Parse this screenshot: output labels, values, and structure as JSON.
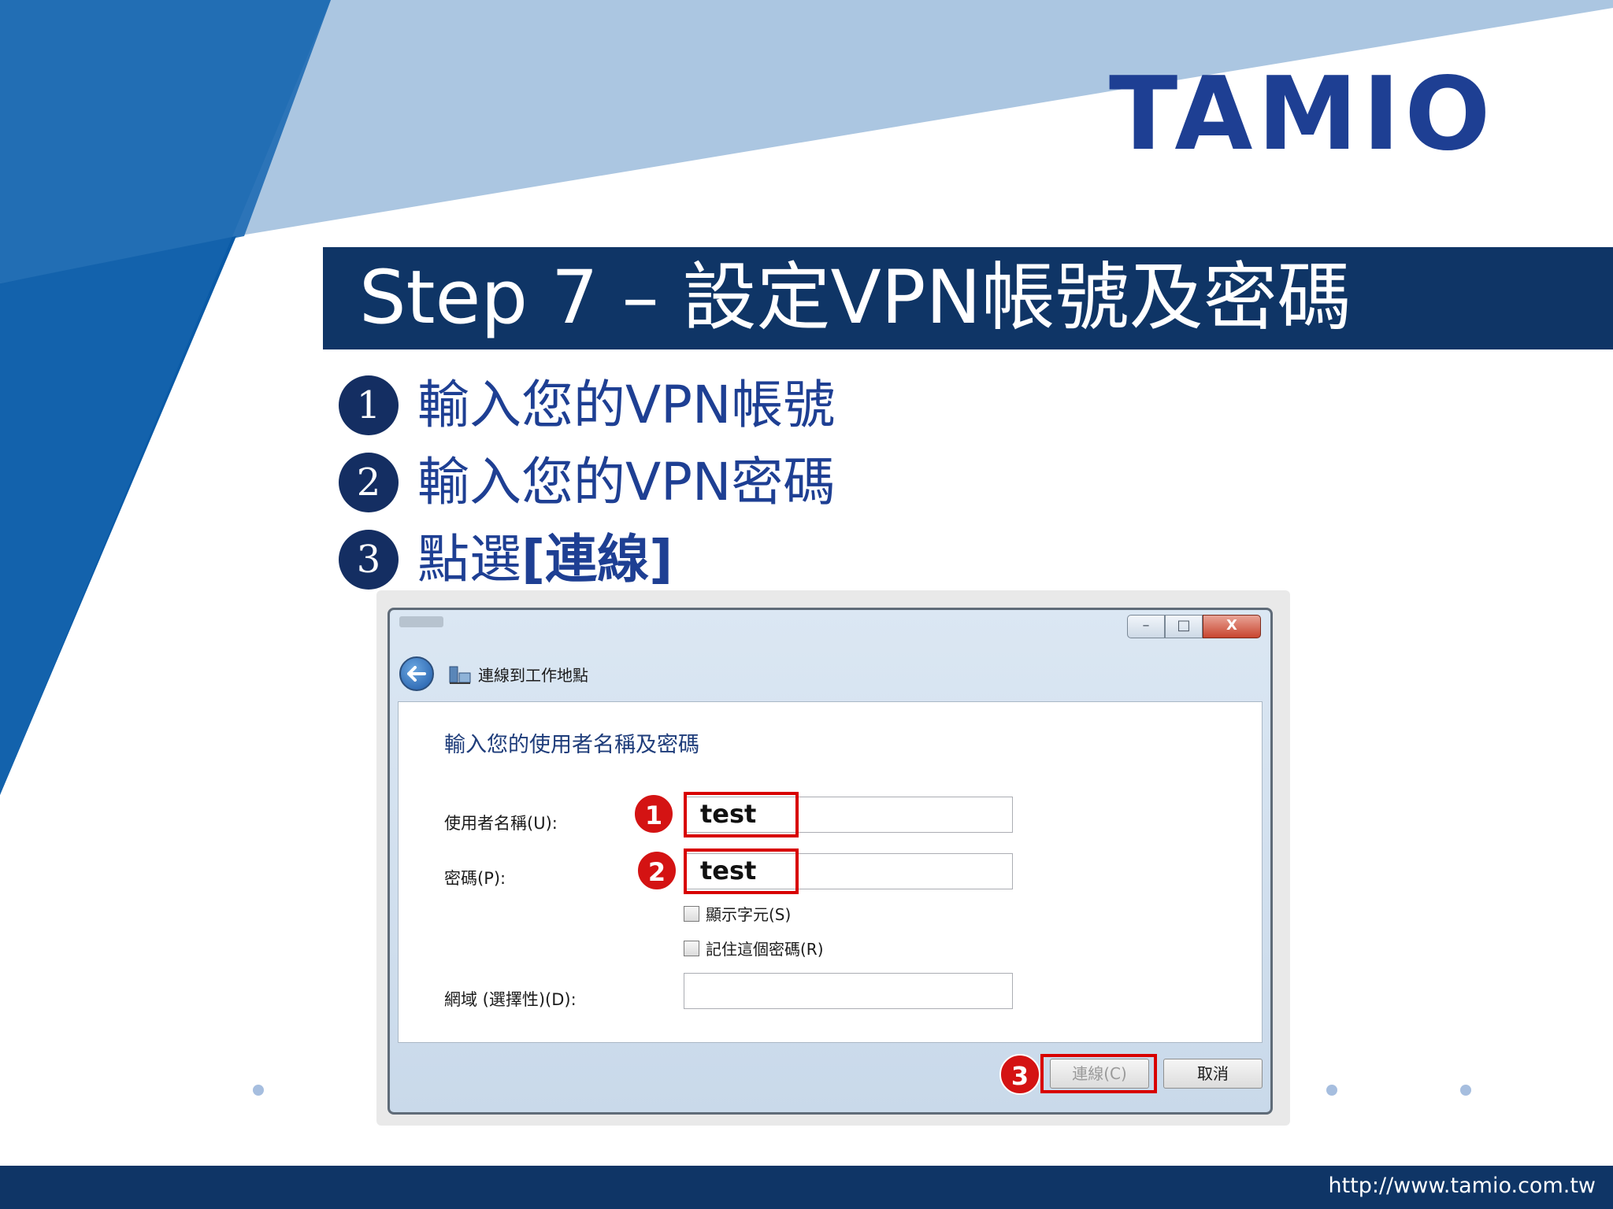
{
  "brand": {
    "logo_text": "TAMIO",
    "logo_color": "#1e3f93"
  },
  "title": "Step 7 – 設定VPN帳號及密碼",
  "steps": [
    {
      "num": "1",
      "text": "輸入您的VPN帳號"
    },
    {
      "num": "2",
      "text": "輸入您的VPN密碼"
    },
    {
      "num": "3",
      "text_prefix": "點選",
      "text_bold": "[連線]"
    }
  ],
  "dialog": {
    "window_controls": {
      "minimize": "–",
      "maximize": "□",
      "close": "X"
    },
    "nav_title": "連線到工作地點",
    "heading": "輸入您的使用者名稱及密碼",
    "username_label": "使用者名稱(U):",
    "username_value": "test",
    "password_label": "密碼(P):",
    "password_value": "test",
    "show_chars_label": "顯示字元(S)",
    "remember_label": "記住這個密碼(R)",
    "domain_label": "網域 (選擇性)(D):",
    "domain_value": "",
    "connect_button": "連線(C)",
    "cancel_button": "取消",
    "badges": [
      "1",
      "2",
      "3"
    ],
    "highlight_color": "#d80000"
  },
  "footer": {
    "url": "http://www.tamio.com.tw"
  },
  "colors": {
    "navy": "#0f3566",
    "accent_blue": "#1e3f93",
    "light_blue": "#a9c4df"
  }
}
